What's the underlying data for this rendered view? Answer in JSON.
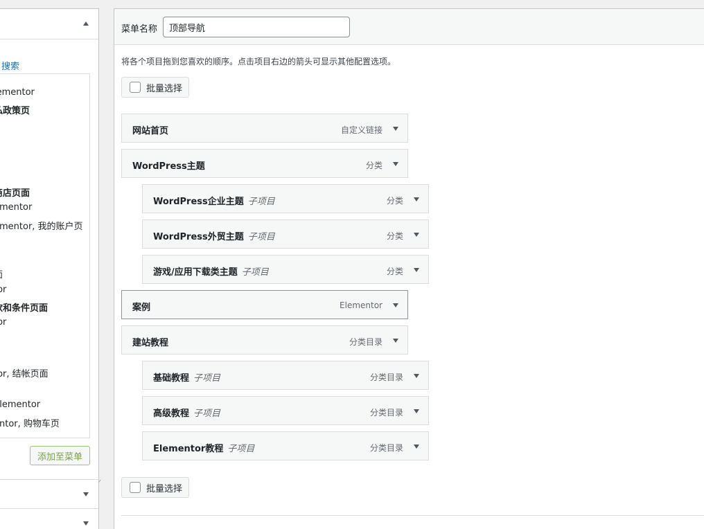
{
  "left": {
    "search_link": "搜索",
    "list_items": [
      {
        "text": "lementor",
        "bold": false
      },
      {
        "text": "私政策页",
        "bold": true
      },
      {
        "text": "商店页面",
        "bold": true
      },
      {
        "text": "ementor",
        "bold": false
      },
      {
        "text": "ementor, 我的账户页",
        "bold": false
      },
      {
        "text": "面",
        "bold": false
      },
      {
        "text": "tor",
        "bold": false
      },
      {
        "text": "款和条件页面",
        "bold": true
      },
      {
        "text": "tor",
        "bold": false
      },
      {
        "text": "tor, 结帐页面",
        "bold": false
      },
      {
        "text": "Elementor",
        "bold": false
      },
      {
        "text": "entor, 购物车页",
        "bold": false
      }
    ],
    "add_button": "添加至菜单"
  },
  "menu": {
    "name_label": "菜单名称",
    "name_value": "顶部导航",
    "instructions": "将各个项目拖到您喜欢的顺序。点击项目右边的箭头可显示其他配置选项。",
    "bulk_select": "批量选择",
    "items": [
      {
        "title": "网站首页",
        "sub": "",
        "type": "自定义链接",
        "level": 0
      },
      {
        "title": "WordPress主题",
        "sub": "",
        "type": "分类",
        "level": 0
      },
      {
        "title": "WordPress企业主题",
        "sub": "子项目",
        "type": "分类",
        "level": 1
      },
      {
        "title": "WordPress外贸主题",
        "sub": "子项目",
        "type": "分类",
        "level": 1
      },
      {
        "title": "游戏/应用下载类主题",
        "sub": "子项目",
        "type": "分类",
        "level": 1
      },
      {
        "title": "案例",
        "sub": "",
        "type": "Elementor",
        "level": 0
      },
      {
        "title": "建站教程",
        "sub": "",
        "type": "分类目录",
        "level": 0
      },
      {
        "title": "基础教程",
        "sub": "子项目",
        "type": "分类目录",
        "level": 1
      },
      {
        "title": "高级教程",
        "sub": "子项目",
        "type": "分类目录",
        "level": 1
      },
      {
        "title": "Elementor教程",
        "sub": "子项目",
        "type": "分类目录",
        "level": 1
      }
    ]
  }
}
